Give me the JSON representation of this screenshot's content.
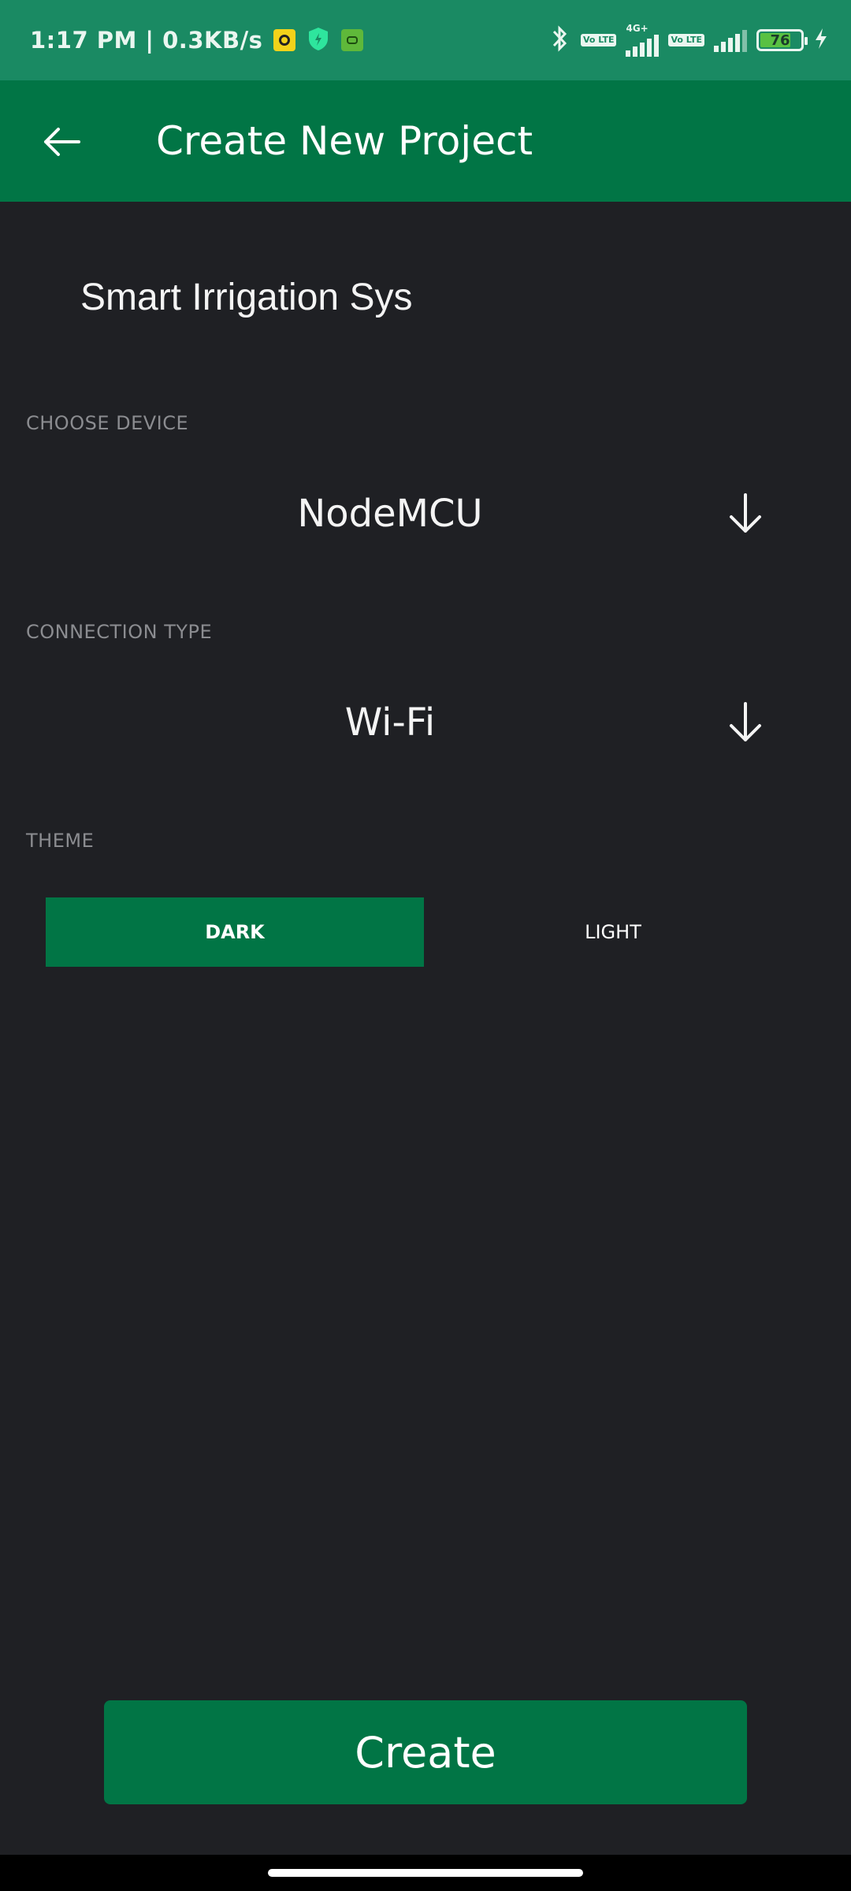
{
  "status_bar": {
    "time_speed": "1:17 PM | 0.3KB/s",
    "network": "4G+",
    "volte_1": "Vo LTE",
    "volte_2": "Vo LTE",
    "battery": "76",
    "battery_level_percent": 76,
    "icons": [
      "bluetooth-icon",
      "volte-icon",
      "signal-icon",
      "battery-icon",
      "charging-icon"
    ]
  },
  "app_bar": {
    "title": "Create New Project",
    "back_icon": "arrow-left-icon"
  },
  "form": {
    "project_name": "Smart Irrigation Sys",
    "device_label": "CHOOSE DEVICE",
    "device_value": "NodeMCU",
    "connection_label": "CONNECTION TYPE",
    "connection_value": "Wi-Fi",
    "theme_label": "THEME",
    "theme_options": [
      "DARK",
      "LIGHT"
    ],
    "theme_selected": "DARK"
  },
  "actions": {
    "create_label": "Create"
  },
  "colors": {
    "status_bar": "#1a8a63",
    "app_bar": "#017545",
    "background": "#1f2024",
    "accent": "#017545",
    "label": "#8b8c90"
  }
}
